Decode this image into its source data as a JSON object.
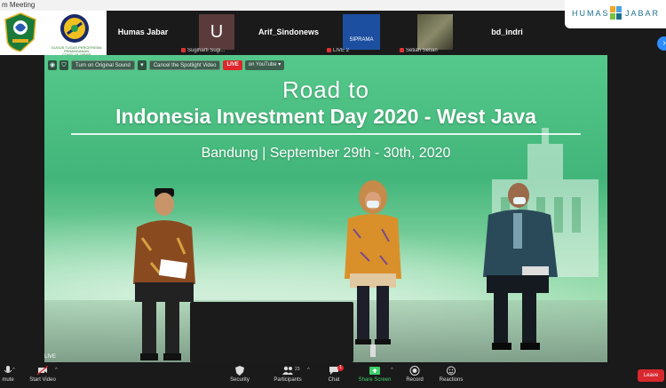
{
  "window": {
    "title": "m Meeting"
  },
  "logos": {
    "covid_text_line1": "GUGUS TUGAS PERCEPATAN PENANGANAN",
    "covid_text_line2": "COVID-19 JABAR"
  },
  "gallery": {
    "tiles": [
      {
        "name": "Humas Jabar",
        "caption": ""
      },
      {
        "name": "",
        "caption": "Sugiharti Sugi...",
        "avatar_letter": "U"
      },
      {
        "name": "Arif_Sindonews",
        "caption": ""
      },
      {
        "name": "",
        "caption": "LIVE 2",
        "avatar_text": "SIPRAMA"
      },
      {
        "name": "",
        "caption": "Setian Setian"
      },
      {
        "name": "bd_indri",
        "caption": ""
      }
    ],
    "next_icon": "chevron-right-icon"
  },
  "branding": {
    "humas": "HUMAS",
    "jabar": "JABAR"
  },
  "video": {
    "toolbar": {
      "original_sound": "Turn on Original Sound",
      "cancel_spotlight": "Cancel the Spotlight Video",
      "live": "LIVE",
      "youtube": "on YouTube"
    },
    "title_line1": "Road to",
    "title_line2": "Indonesia Investment Day 2020 - West Java",
    "subtitle": "Bandung | September 29th - 30th, 2020",
    "live_tag": "LIVE"
  },
  "controls": {
    "mute": "mute",
    "start_video": "Start Video",
    "security": "Security",
    "participants": "Participants",
    "participants_count": "23",
    "chat": "Chat",
    "chat_badge": "1",
    "share_screen": "Share Screen",
    "record": "Record",
    "reactions": "Reactions",
    "leave": "Leave"
  },
  "colors": {
    "accent_blue": "#2d8cff",
    "live_red": "#e0262b",
    "share_green": "#3ecf6a",
    "stage_green": "#4dbf84"
  }
}
